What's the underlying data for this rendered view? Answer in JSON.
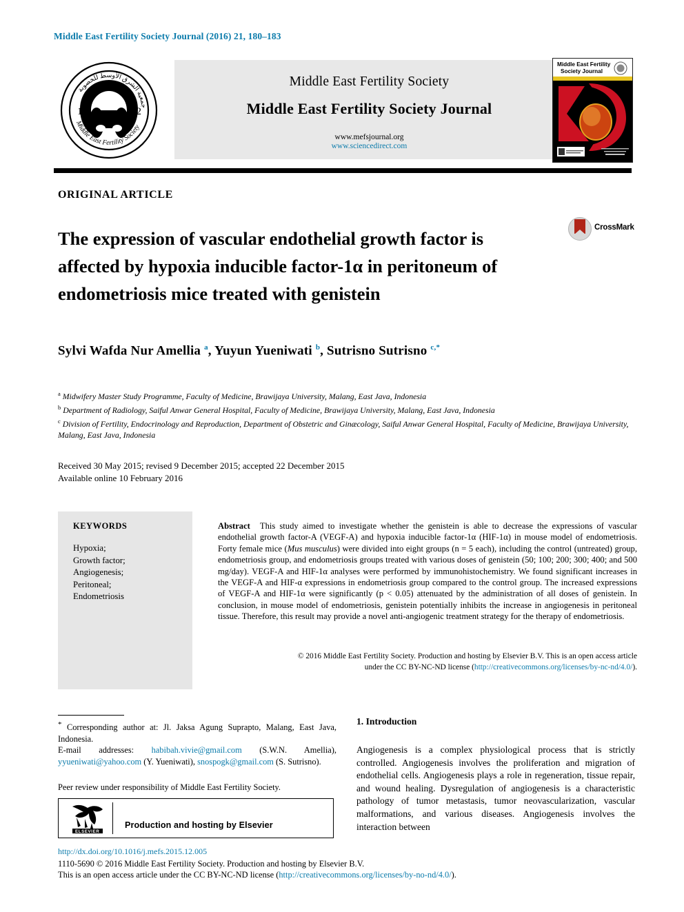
{
  "running_head": "Middle East Fertility Society Journal (2016) 21, 180–183",
  "masthead": {
    "society_line": "Middle East Fertility Society",
    "journal_line": "Middle East Fertility Society Journal",
    "url_primary": "www.mefsjournal.org",
    "url_secondary": "www.sciencedirect.com",
    "society_logo_name": "middle-east-fertility-society-logo",
    "cover_title_line1": "Middle East Fertility",
    "cover_title_line2": "Society Journal"
  },
  "article_type": "ORIGINAL ARTICLE",
  "title": "The expression of vascular endothelial growth factor is affected by hypoxia inducible factor-1α in peritoneum of endometriosis mice treated with genistein",
  "crossmark": {
    "label": "CrossMark"
  },
  "authors": {
    "list": [
      {
        "name": "Sylvi Wafda Nur Amellia",
        "marks": "a"
      },
      {
        "name": "Yuyun Yueniwati",
        "marks": "b"
      },
      {
        "name": "Sutrisno Sutrisno",
        "marks": "c,*"
      }
    ]
  },
  "affiliations": [
    {
      "mark": "a",
      "text": "Midwifery Master Study Programme, Faculty of Medicine, Brawijaya University, Malang, East Java, Indonesia"
    },
    {
      "mark": "b",
      "text": "Department of Radiology, Saiful Anwar General Hospital, Faculty of Medicine, Brawijaya University, Malang, East Java, Indonesia"
    },
    {
      "mark": "c",
      "text": "Division of Fertility, Endocrinology and Reproduction, Department of Obstetric and Ginæcology, Saiful Anwar General Hospital, Faculty of Medicine, Brawijaya University, Malang, East Java, Indonesia"
    }
  ],
  "dates": {
    "line1": "Received 30 May 2015; revised 9 December 2015; accepted 22 December 2015",
    "line2": "Available online 10 February 2016"
  },
  "keywords": {
    "heading": "KEYWORDS",
    "items": [
      "Hypoxia;",
      "Growth factor;",
      "Angiogenesis;",
      "Peritoneal;",
      "Endometriosis"
    ]
  },
  "abstract": {
    "label": "Abstract",
    "body_part1": "This study aimed to investigate whether the genistein is able to decrease the expressions of vascular endothelial growth factor-A (VEGF-A) and hypoxia inducible factor-1α (HIF-1α) in mouse model of endometriosis. Forty female mice (",
    "species": "Mus musculus",
    "body_part2": ") were divided into eight groups (n = 5 each), including the control (untreated) group, endometriosis group, and endometriosis groups treated with various doses of genistein (50; 100; 200; 300; 400; and 500 mg/day). VEGF-A and HIF-1α analyses were performed by immunohistochemistry. We found significant increases in the VEGF-A and HIF-α expressions in endometriosis group compared to the control group. The increased expressions of VEGF-A and HIF-1α were significantly (p < 0.05) attenuated by the administration of all doses of genistein. In conclusion, in mouse model of endometriosis, genistein potentially inhibits the increase in angiogenesis in peritoneal tissue. Therefore, this result may provide a novel anti-angiogenic treatment strategy for the therapy of endometriosis.",
    "copyright_line1": "© 2016 Middle East Fertility Society. Production and hosting by Elsevier B.V. This is an open access article",
    "copyright_line2_pre": "under the CC BY-NC-ND license (",
    "copyright_license_url": "http://creativecommons.org/licenses/by-nc-nd/4.0/",
    "copyright_line2_post": ")."
  },
  "footnote": {
    "corresponding": "Corresponding author at: Jl. Jaksa Agung Suprapto, Malang, East Java, Indonesia.",
    "email_label": "E-mail addresses:",
    "emails": [
      {
        "address": "habibah.vivie@gmail.com",
        "owner": "(S.W.N. Amellia),"
      },
      {
        "address": "yyueniwati@yahoo.com",
        "owner": "(Y. Yueniwati),"
      },
      {
        "address": "snospogk@gmail.com",
        "owner": "(S. Sutrisno)."
      }
    ],
    "peer_review": "Peer review under responsibility of Middle East Fertility Society."
  },
  "elsevier_box": {
    "text": "Production and hosting by Elsevier",
    "logo_label": "ELSEVIER"
  },
  "bottom": {
    "doi": "http://dx.doi.org/10.1016/j.mefs.2015.12.005",
    "issn_line": "1110-5690 © 2016 Middle East Fertility Society. Production and hosting by Elsevier B.V.",
    "license_pre": "This is an open access article under the CC BY-NC-ND license (",
    "license_url": "http://creativecommons.org/licenses/by-no-nd/4.0/",
    "license_post": ")."
  },
  "introduction": {
    "heading": "1. Introduction",
    "body": "Angiogenesis is a complex physiological process that is strictly controlled. Angiogenesis involves the proliferation and migration of endothelial cells. Angiogenesis plays a role in regeneration, tissue repair, and wound healing. Dysregulation of angiogenesis is a characteristic pathology of tumor metastasis, tumor neovascularization, vascular malformations, and various diseases. Angiogenesis involves the interaction between"
  },
  "colors": {
    "link_blue": "#0b7bab",
    "panel_gray": "#e6e6e6",
    "masthead_gray": "#e8e8e8",
    "cover_red": "#cc1122",
    "crossmark_red": "#b02418"
  }
}
